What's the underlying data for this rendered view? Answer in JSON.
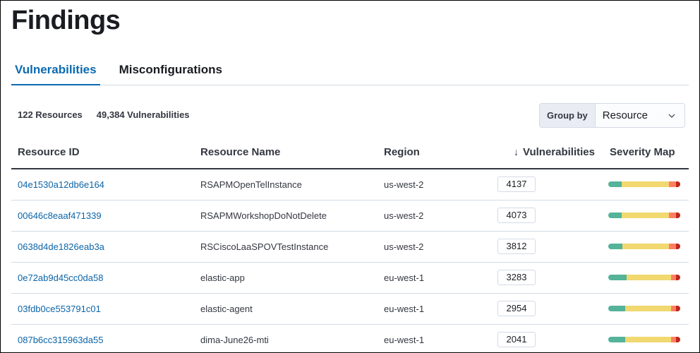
{
  "page": {
    "title": "Findings"
  },
  "tabs": [
    {
      "label": "Vulnerabilities",
      "active": true
    },
    {
      "label": "Misconfigurations",
      "active": false
    }
  ],
  "summary": {
    "resources": "122 Resources",
    "vulnerabilities": "49,384 Vulnerabilities"
  },
  "group_by": {
    "label": "Group by",
    "value": "Resource",
    "icon": "chevron-down-icon"
  },
  "table": {
    "columns": [
      {
        "label": "Resource ID"
      },
      {
        "label": "Resource Name"
      },
      {
        "label": "Region"
      },
      {
        "label": "Vulnerabilities",
        "sort": "descending",
        "sort_icon": "arrow-down-icon"
      },
      {
        "label": "Severity Map"
      }
    ],
    "severity_colors": {
      "low": "#54b399",
      "medium": "#f1d86f",
      "high": "#ff7e62",
      "critical": "#bd271e"
    },
    "rows": [
      {
        "resource_id": "04e1530a12db6e164",
        "resource_name": "RSAPMOpenTelInstance",
        "region": "us-west-2",
        "vulnerabilities": "4137",
        "severity": {
          "low": 0.19,
          "medium": 0.65,
          "high": 0.1,
          "critical": 0.06
        }
      },
      {
        "resource_id": "00646c8eaaf471339",
        "resource_name": "RSAPMWorkshopDoNotDelete",
        "region": "us-west-2",
        "vulnerabilities": "4073",
        "severity": {
          "low": 0.19,
          "medium": 0.65,
          "high": 0.1,
          "critical": 0.06
        }
      },
      {
        "resource_id": "0638d4de1826eab3a",
        "resource_name": "RSCiscoLaaSPOVTestInstance",
        "region": "us-west-2",
        "vulnerabilities": "3812",
        "severity": {
          "low": 0.2,
          "medium": 0.64,
          "high": 0.1,
          "critical": 0.06
        }
      },
      {
        "resource_id": "0e72ab9d45cc0da58",
        "resource_name": "elastic-app",
        "region": "eu-west-1",
        "vulnerabilities": "3283",
        "severity": {
          "low": 0.25,
          "medium": 0.62,
          "high": 0.07,
          "critical": 0.06
        }
      },
      {
        "resource_id": "03fdb0ce553791c01",
        "resource_name": "elastic-agent",
        "region": "eu-west-1",
        "vulnerabilities": "2954",
        "severity": {
          "low": 0.24,
          "medium": 0.63,
          "high": 0.07,
          "critical": 0.06
        }
      },
      {
        "resource_id": "087b6cc315963da55",
        "resource_name": "dima-June26-mti",
        "region": "eu-west-1",
        "vulnerabilities": "2041",
        "severity": {
          "low": 0.24,
          "medium": 0.63,
          "high": 0.07,
          "critical": 0.06
        }
      }
    ]
  }
}
